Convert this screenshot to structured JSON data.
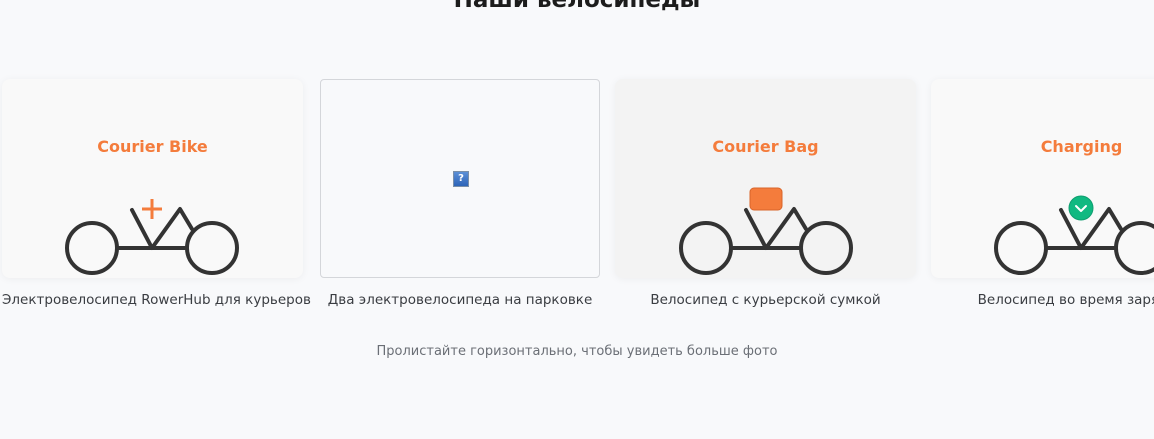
{
  "section": {
    "title": "Наши велосипеды"
  },
  "gallery": {
    "slides": [
      {
        "label": "Courier Bike",
        "accessory": "plus-icon",
        "caption": "Электровелосипед RowerHub для курьеров",
        "background": "#f9f9f9"
      },
      {
        "label": "",
        "accessory": "broken-image-icon",
        "broken_image_glyph": "?",
        "caption": "Два электровелосипеда на парковке",
        "background": "#f8f9fb"
      },
      {
        "label": "Courier Bag",
        "accessory": "bag-icon",
        "caption": "Велосипед с курьерской сумкой",
        "background": "#f3f3f3"
      },
      {
        "label": "Charging",
        "accessory": "charging-check-icon",
        "caption": "Велосипед во время зарядки",
        "background": "#f9f9f9"
      }
    ]
  },
  "hint": "Пролистайте горизонтально, чтобы увидеть больше фото",
  "colors": {
    "accent": "#f47c3c",
    "bike_stroke": "#333333",
    "charging_green": "#10b981",
    "caption_text": "#3a3d42",
    "hint_text": "#6b6f76"
  }
}
